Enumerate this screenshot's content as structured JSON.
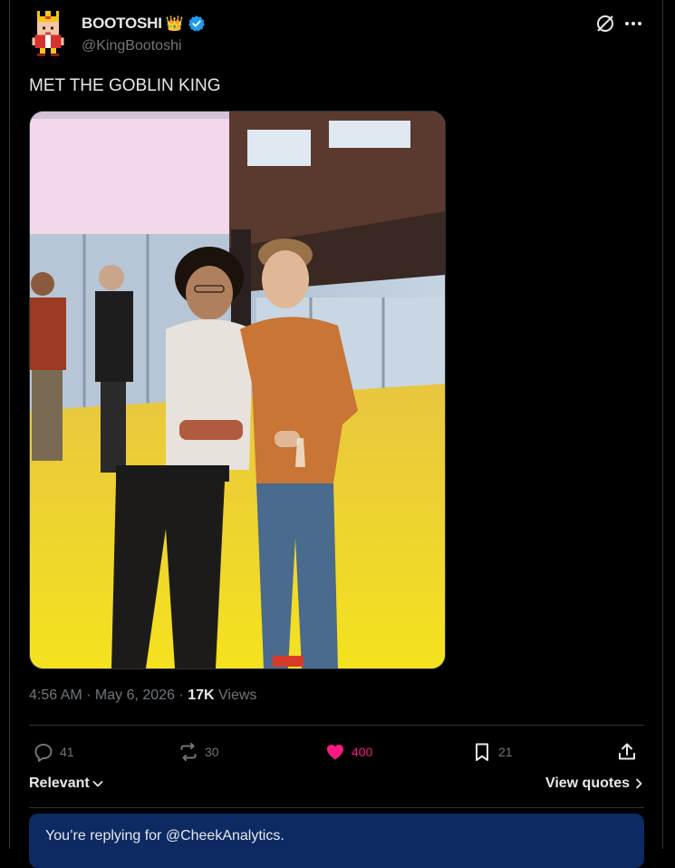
{
  "author": {
    "display_name": "BOOTOSHI",
    "crown_emoji": "👑",
    "handle": "@KingBootoshi"
  },
  "tweet": {
    "text": "MET THE GOBLIN KING",
    "time": "4:56 AM",
    "date": "May 6, 2026",
    "views_count": "17K",
    "views_label": "Views"
  },
  "actions": {
    "replies": "41",
    "reposts": "30",
    "likes": "400",
    "bookmarks": "21"
  },
  "replies_section": {
    "sort_label": "Relevant",
    "quotes_label": "View quotes",
    "reply_banner": "You’re replying for @CheekAnalytics."
  },
  "colors": {
    "background": "#000000",
    "text": "#e7e9ea",
    "muted": "#71767b",
    "verified": "#1d9bf0",
    "like": "#f91880",
    "banner": "#0d2a63",
    "border": "#2f3336"
  },
  "icons": [
    "verified-badge-icon",
    "grok-icon",
    "more-icon",
    "reply-icon",
    "repost-icon",
    "heart-icon",
    "bookmark-icon",
    "share-icon",
    "chevron-down-icon",
    "chevron-right-icon"
  ]
}
